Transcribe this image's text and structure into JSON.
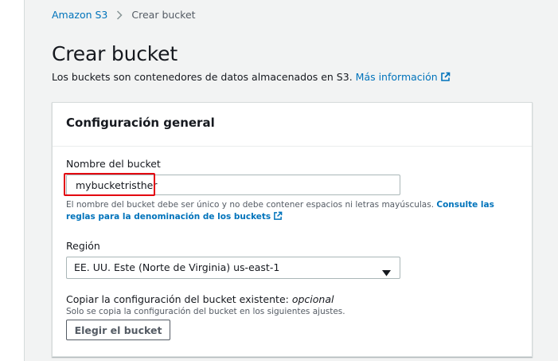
{
  "breadcrumb": {
    "root": "Amazon S3",
    "current": "Crear bucket"
  },
  "page": {
    "title": "Crear bucket",
    "description": "Los buckets son contenedores de datos almacenados en S3.",
    "more_info_link": "Más información"
  },
  "panel": {
    "title": "Configuración general",
    "bucket_name": {
      "label": "Nombre del bucket",
      "value": "mybucketristher",
      "help_text": "El nombre del bucket debe ser único y no debe contener espacios ni letras mayúsculas.",
      "help_link": "Consulte las reglas para la denominación de los buckets"
    },
    "region": {
      "label": "Región",
      "selected": "EE. UU. Este (Norte de Virginia) us-east-1"
    },
    "copy_settings": {
      "label": "Copiar la configuración del bucket existente:",
      "optional": "opcional",
      "hint": "Solo se copia la configuración del bucket en los siguientes ajustes.",
      "button_label": "Elegir el bucket"
    }
  },
  "colors": {
    "link": "#0073bb",
    "highlight": "#e3000f",
    "background": "#f2f3f3"
  },
  "icons": [
    "chevron-right-icon",
    "external-link-icon",
    "caret-down-icon"
  ]
}
